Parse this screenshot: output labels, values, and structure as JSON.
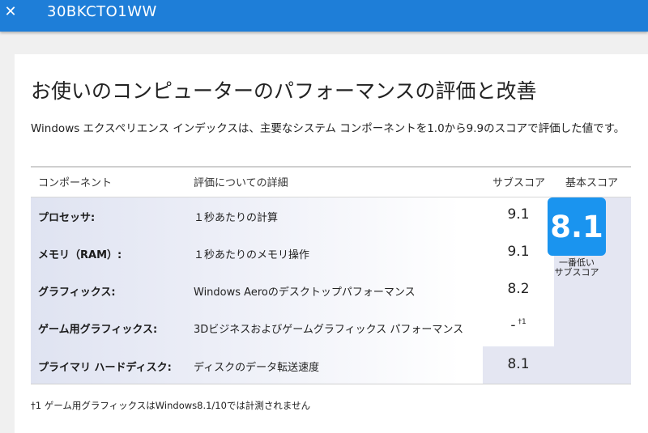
{
  "topbar": {
    "close_glyph": "✕",
    "title": "30BKCTO1WW"
  },
  "page": {
    "heading": "お使いのコンピューターのパフォーマンスの評価と改善",
    "description": "Windows エクスペリエンス インデックスは、主要なシステム コンポーネントを1.0から9.9のスコアで評価した値です。"
  },
  "table": {
    "headers": {
      "component": "コンポーネント",
      "detail": "評価についての詳細",
      "subscore": "サブスコア",
      "base": "基本スコア"
    },
    "rows": [
      {
        "component": "プロセッサ:",
        "detail": "１秒あたりの計算",
        "subscore": "9.1",
        "mark": ""
      },
      {
        "component": "メモリ（RAM）:",
        "detail": "１秒あたりのメモリ操作",
        "subscore": "9.1",
        "mark": ""
      },
      {
        "component": "グラフィックス:",
        "detail": "Windows Aeroのデスクトップパフォーマンス",
        "subscore": "8.2",
        "mark": ""
      },
      {
        "component": "ゲーム用グラフィックス:",
        "detail": "3Dビジネスおよびゲームグラフィックス パフォーマンス",
        "subscore": "-",
        "mark": "†1"
      },
      {
        "component": "プライマリ ハードディスク:",
        "detail": "ディスクのデータ転送速度",
        "subscore": "8.1",
        "mark": ""
      }
    ],
    "base_score": "8.1",
    "base_label_line1": "一番低い",
    "base_label_line2": "サブスコア"
  },
  "footnote": "†1 ゲーム用グラフィックスはWindows8.1/10では計測されません",
  "colors": {
    "topbar": "#1e7ed8",
    "badge": "#1a94ef",
    "base_column": "#e4e6f2"
  }
}
